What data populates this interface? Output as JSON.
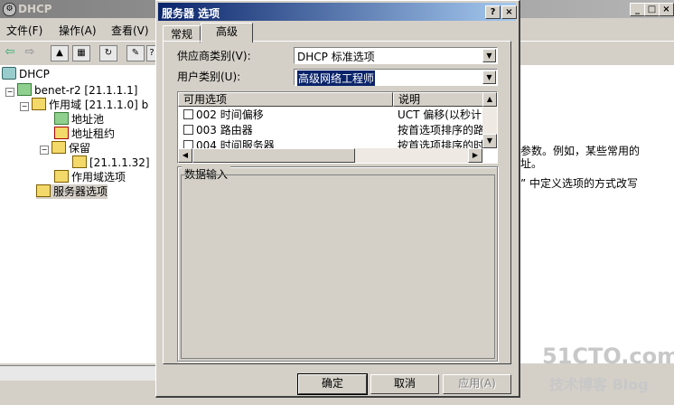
{
  "background_window": {
    "title": "DHCP",
    "menu": [
      "文件(F)",
      "操作(A)",
      "查看(V)"
    ],
    "tree": {
      "root": "DHCP",
      "server": "benet-r2 [21.1.1.1]",
      "scope": "作用域 [21.1.1.0] b",
      "address_pool": "地址池",
      "address_leases": "地址租约",
      "reservations": "保留",
      "reservation_item": "[21.1.1.32]",
      "scope_options": "作用域选项",
      "server_options": "服务器选项"
    },
    "right_text": [
      "参数。例如，某些常用的",
      "址。",
      "” 中定义选项的方式改写"
    ]
  },
  "dialog": {
    "title": "服务器 选项",
    "help_btn": "?",
    "close_btn": "×",
    "tabs": [
      "常规",
      "高级"
    ],
    "active_tab": 1,
    "vendor_class_label": "供应商类别(V):",
    "vendor_class_value": "DHCP 标准选项",
    "user_class_label": "用户类别(U):",
    "user_class_value": "高级网络工程师",
    "list": {
      "headers": [
        "可用选项",
        "说明"
      ],
      "rows": [
        {
          "option": "002 时间偏移",
          "desc": "UCT 偏移(以秒计)",
          "checked": false
        },
        {
          "option": "003 路由器",
          "desc": "按首选项排序的路",
          "checked": false
        },
        {
          "option": "004 时间服务器",
          "desc": "按首选项排序的时",
          "checked": false
        }
      ]
    },
    "data_entry_label": "数据输入",
    "buttons": {
      "ok": "确定",
      "cancel": "取消",
      "apply": "应用(A)"
    }
  },
  "watermark": {
    "line1": "51CTO.com",
    "line2": "技术博客 Blog"
  }
}
